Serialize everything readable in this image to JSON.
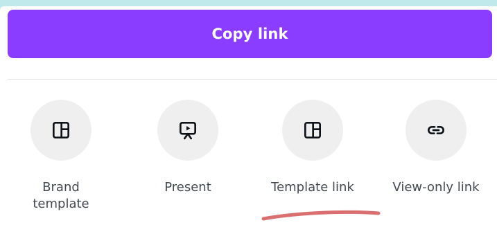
{
  "share_panel": {
    "copy_link_label": "Copy link",
    "options": [
      {
        "label": "Brand\ntemplate",
        "icon": "template-layout-icon"
      },
      {
        "label": "Present",
        "icon": "presentation-icon"
      },
      {
        "label": "Template link",
        "icon": "template-layout-icon"
      },
      {
        "label": "View-only link",
        "icon": "link-icon"
      }
    ]
  },
  "colors": {
    "accent": "#8b3dff",
    "background": "#bfe9ea",
    "icon_circle": "#efeff0",
    "label_text": "#444a51",
    "annotation_underline": "#d9706f"
  }
}
